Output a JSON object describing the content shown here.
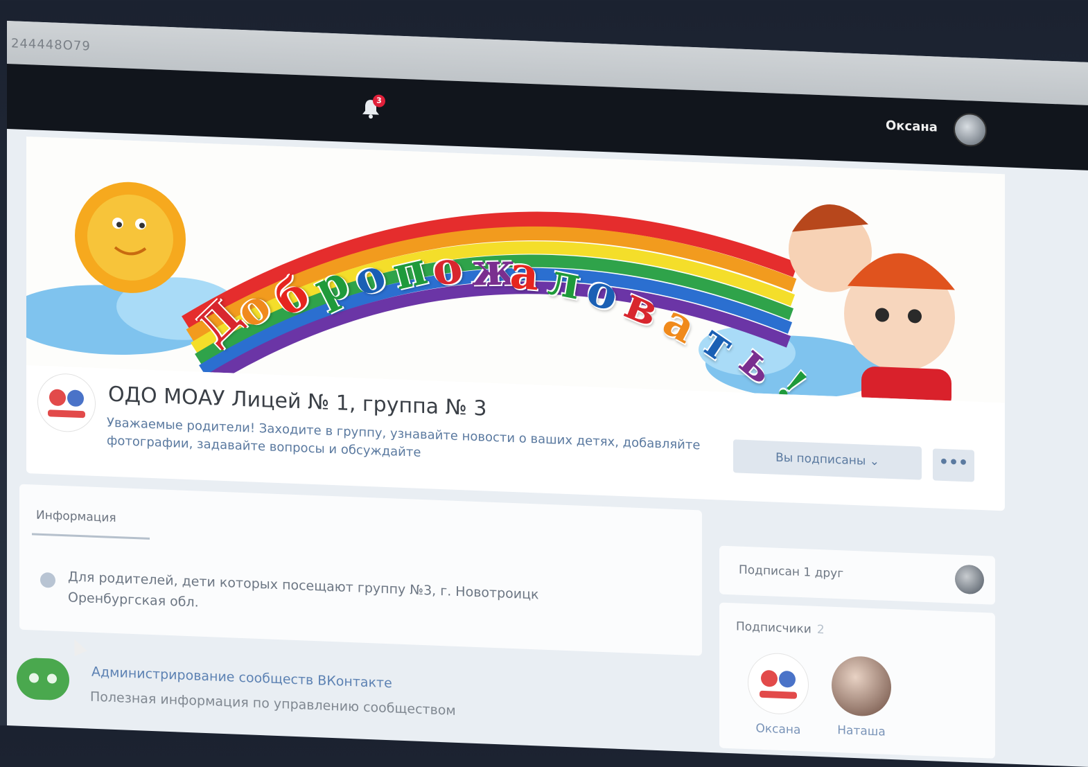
{
  "browser": {
    "url_fragment": "244448О79"
  },
  "topnav": {
    "notification_count": "3",
    "user_name": "Оксана"
  },
  "cover": {
    "welcome_letters": [
      {
        "ch": "Д",
        "color": "#d8262e"
      },
      {
        "ch": "о",
        "color": "#f08a1c"
      },
      {
        "ch": "б",
        "color": "#e6251f"
      },
      {
        "ch": "р",
        "color": "#1f9a3b"
      },
      {
        "ch": "о",
        "color": "#1a5fb4"
      },
      {
        "ch": "п",
        "color": "#1f9a3b"
      },
      {
        "ch": "о",
        "color": "#d8262e"
      },
      {
        "ch": "ж",
        "color": "#7a2f8f"
      },
      {
        "ch": "а",
        "color": "#e6251f"
      },
      {
        "ch": "л",
        "color": "#1f9a3b"
      },
      {
        "ch": "о",
        "color": "#1a5fb4"
      },
      {
        "ch": "в",
        "color": "#d8262e"
      },
      {
        "ch": "а",
        "color": "#f08a1c"
      },
      {
        "ch": "т",
        "color": "#1a5fb4"
      },
      {
        "ch": "ь",
        "color": "#7a2f8f"
      },
      {
        "ch": "!",
        "color": "#1f9a3b"
      }
    ]
  },
  "group": {
    "title": "ОДО МОАУ Лицей № 1, группа № 3",
    "description": "Уважаемые родители! Заходите в группу, узнавайте новости о ваших детях, добавляйте фотографии, задавайте вопросы и обсуждайте",
    "subscribe_label": "Вы подписаны ⌄",
    "more_label": "•••"
  },
  "info": {
    "tab_label": "Информация",
    "text": "Для родителей, дети которых посещают группу №3, г. Новотроицк Оренбургская обл."
  },
  "admin_link": {
    "title": "Администрирование сообществ ВКонтакте",
    "subtitle": "Полезная информация по управлению сообществом"
  },
  "sidebar": {
    "friend_text": "Подписан 1 друг",
    "subscribers_title": "Подписчики",
    "subscribers_count": "2",
    "subscribers": [
      {
        "name": "Оксана"
      },
      {
        "name": "Наташа"
      }
    ]
  }
}
